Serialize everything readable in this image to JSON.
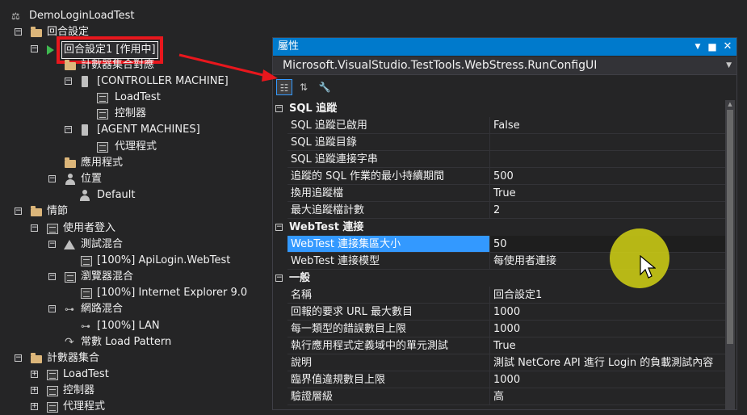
{
  "tree": {
    "root": "DemoLoginLoadTest",
    "items": [
      {
        "label": "回合設定"
      },
      {
        "label": "回合設定1 [作用中]"
      },
      {
        "label": "計數器集合對應"
      },
      {
        "label": "[CONTROLLER MACHINE]"
      },
      {
        "label": "LoadTest"
      },
      {
        "label": "控制器"
      },
      {
        "label": "[AGENT MACHINES]"
      },
      {
        "label": "代理程式"
      },
      {
        "label": "應用程式"
      },
      {
        "label": "位置"
      },
      {
        "label": "Default"
      },
      {
        "label": "情節"
      },
      {
        "label": "使用者登入"
      },
      {
        "label": "測試混合"
      },
      {
        "label": "[100%] ApiLogin.WebTest"
      },
      {
        "label": "瀏覽器混合"
      },
      {
        "label": "[100%] Internet Explorer 9.0"
      },
      {
        "label": "網路混合"
      },
      {
        "label": "[100%] LAN"
      },
      {
        "label": "常數 Load Pattern"
      },
      {
        "label": "計數器集合"
      },
      {
        "label": "LoadTest"
      },
      {
        "label": "控制器"
      },
      {
        "label": "代理程式"
      }
    ]
  },
  "properties": {
    "title": "屬性",
    "object": "Microsoft.VisualStudio.TestTools.WebStress.RunConfigUI",
    "categories": [
      {
        "name": "SQL 追蹤",
        "props": [
          {
            "name": "SQL 追蹤已啟用",
            "value": "False"
          },
          {
            "name": "SQL 追蹤目錄",
            "value": ""
          },
          {
            "name": "SQL 追蹤連接字串",
            "value": ""
          },
          {
            "name": "追蹤的 SQL 作業的最小持續期間",
            "value": "500"
          },
          {
            "name": "換用追蹤檔",
            "value": "True"
          },
          {
            "name": "最大追蹤檔計數",
            "value": "2"
          }
        ]
      },
      {
        "name": "WebTest 連接",
        "props": [
          {
            "name": "WebTest 連接集區大小",
            "value": "50"
          },
          {
            "name": "WebTest 連接模型",
            "value": "每使用者連接"
          }
        ]
      },
      {
        "name": "一般",
        "props": [
          {
            "name": "名稱",
            "value": "回合設定1"
          },
          {
            "name": "回報的要求 URL 最大數目",
            "value": "1000"
          },
          {
            "name": "每一類型的錯誤數目上限",
            "value": "1000"
          },
          {
            "name": "執行應用程式定義域中的單元測試",
            "value": "True"
          },
          {
            "name": "說明",
            "value": "測試 NetCore API 進行 Login 的負載測試內容"
          },
          {
            "name": "臨界值違規數目上限",
            "value": "1000"
          },
          {
            "name": "驗證層級",
            "value": "高"
          }
        ]
      }
    ]
  },
  "colors": {
    "accent": "#007acc",
    "highlight": "#e8171d",
    "selection": "#3399ff",
    "cursor": "#d2d214"
  }
}
